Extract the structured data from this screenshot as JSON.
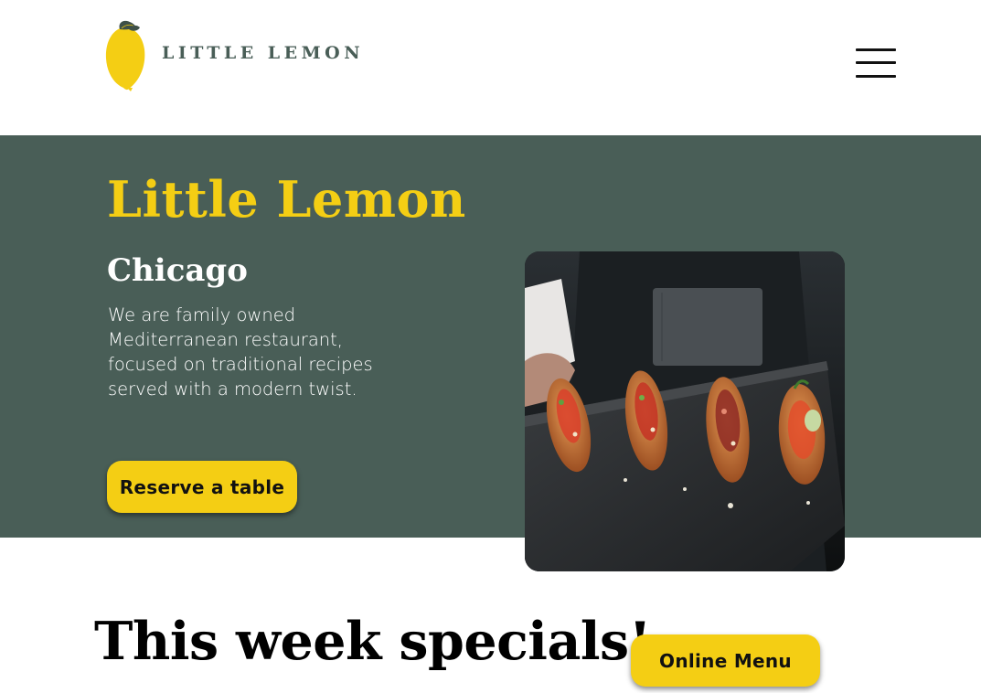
{
  "header": {
    "logo_text": "LITTLE LEMON",
    "logo_icon": "lemon-logo-icon",
    "menu_icon": "hamburger-menu-icon"
  },
  "hero": {
    "title": "Little Lemon",
    "city": "Chicago",
    "description": "We are family owned Mediterranean restaurant, focused on traditional recipes served with a modern twist.",
    "reserve_button": "Reserve a table",
    "image_icon": "food-platter-image"
  },
  "specials": {
    "title": "This week specials!",
    "menu_button": "Online Menu"
  },
  "colors": {
    "brand_green": "#495e57",
    "brand_yellow": "#f4ce14",
    "text_dark": "#111111",
    "white": "#ffffff"
  }
}
